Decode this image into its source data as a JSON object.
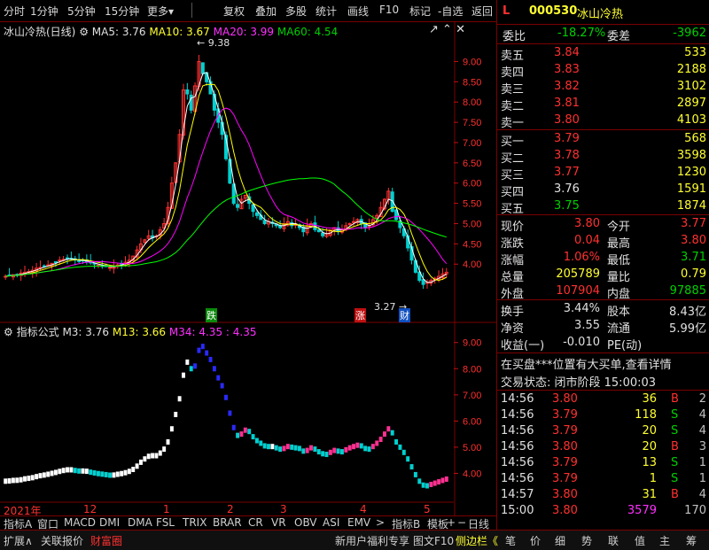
{
  "toolbar": {
    "items": [
      "分时",
      "1分钟",
      "5分钟",
      "15分钟",
      "更多",
      "复权",
      "叠加",
      "多股",
      "统计",
      "画线",
      "F10",
      "标记",
      "-自选",
      "返回"
    ]
  },
  "chart_header": {
    "title": "冰山冷热(日线)",
    "ma5": "MA5: 3.76",
    "ma10": "MA10: 3.67",
    "ma20": "MA20: 3.99",
    "ma60": "MA60: 4.54"
  },
  "indicator_header": {
    "title": "指标公式",
    "m3": "M3: 3.76",
    "m13": "M13: 3.66",
    "m34": "M34: 4.35 : 4.35"
  },
  "annotations": {
    "high": "9.38",
    "low": "3.27",
    "marker_die": "跌",
    "marker_zhang": "涨",
    "marker_cai": "财"
  },
  "colors": {
    "ma5": "#ffffff",
    "ma10": "#ffff00",
    "ma20": "#ff00ff",
    "ma60": "#00ff00",
    "up": "#ff3030",
    "down": "#00d0d0",
    "indicator_strong": "#2a2aff",
    "indicator_weak": "#ff3090"
  },
  "chart_data": {
    "type": "candlestick",
    "title": "冰山冷热(日线)",
    "ylim": [
      3.0,
      9.6
    ],
    "y_ticks": [
      "9.00",
      "8.50",
      "8.00",
      "7.50",
      "7.00",
      "6.50",
      "6.00",
      "5.50",
      "5.00",
      "4.50",
      "4.00"
    ],
    "indicator_ylim": [
      3.0,
      9.6
    ],
    "indicator_ticks": [
      "9.00",
      "8.00",
      "7.00",
      "6.00",
      "5.00",
      "4.00"
    ],
    "x_labels": [
      "2021年",
      "12",
      "1",
      "2",
      "3",
      "4",
      "5"
    ],
    "close": [
      3.7,
      3.72,
      3.74,
      3.73,
      3.78,
      3.8,
      3.82,
      3.85,
      3.9,
      3.92,
      3.95,
      3.98,
      4.02,
      4.05,
      4.1,
      4.12,
      4.15,
      4.12,
      4.1,
      4.08,
      4.1,
      4.06,
      4.03,
      4.0,
      3.98,
      3.96,
      3.94,
      3.92,
      3.95,
      3.98,
      4.0,
      4.05,
      4.1,
      4.2,
      4.35,
      4.5,
      4.6,
      4.7,
      4.65,
      4.7,
      4.85,
      5.0,
      5.4,
      6.0,
      6.5,
      7.2,
      8.3,
      8.2,
      7.8,
      8.4,
      9.0,
      8.7,
      8.5,
      8.2,
      7.8,
      7.5,
      7.2,
      6.6,
      6.0,
      5.5,
      5.4,
      5.6,
      5.7,
      5.5,
      5.3,
      5.2,
      5.1,
      5.0,
      5.05,
      5.0,
      4.95,
      4.9,
      5.0,
      5.05,
      4.95,
      5.0,
      4.9,
      4.8,
      4.95,
      5.0,
      4.85,
      4.8,
      4.7,
      4.75,
      4.85,
      4.9,
      4.8,
      4.85,
      4.95,
      5.0,
      5.05,
      5.1,
      5.0,
      4.9,
      4.95,
      5.1,
      5.2,
      5.4,
      5.6,
      5.8,
      5.3,
      5.1,
      4.9,
      4.7,
      4.4,
      4.1,
      3.8,
      3.6,
      3.5,
      3.55,
      3.6,
      3.65,
      3.7,
      3.76,
      3.8
    ],
    "ma5_last": 3.76,
    "ma10_last": 3.67,
    "ma20_last": 3.99,
    "ma60_last": 4.54,
    "high": 9.38,
    "low": 3.27
  },
  "quote": {
    "code": "000530",
    "name": "冰山冷热",
    "weibi_label": "委比",
    "weibi": "-18.27%",
    "weicha_label": "委差",
    "weicha": "-3962",
    "asks": [
      {
        "label": "卖五",
        "price": "3.84",
        "vol": "533"
      },
      {
        "label": "卖四",
        "price": "3.83",
        "vol": "2188"
      },
      {
        "label": "卖三",
        "price": "3.82",
        "vol": "3102"
      },
      {
        "label": "卖二",
        "price": "3.81",
        "vol": "2897"
      },
      {
        "label": "卖一",
        "price": "3.80",
        "vol": "4103"
      }
    ],
    "bids": [
      {
        "label": "买一",
        "price": "3.79",
        "vol": "568"
      },
      {
        "label": "买二",
        "price": "3.78",
        "vol": "3598"
      },
      {
        "label": "买三",
        "price": "3.77",
        "vol": "1230"
      },
      {
        "label": "买四",
        "price": "3.76",
        "vol": "1591"
      },
      {
        "label": "买五",
        "price": "3.75",
        "vol": "1874"
      }
    ],
    "stats": [
      {
        "l1": "现价",
        "v1": "3.80",
        "l2": "今开",
        "v2": "3.77"
      },
      {
        "l1": "涨跌",
        "v1": "0.04",
        "l2": "最高",
        "v2": "3.80"
      },
      {
        "l1": "涨幅",
        "v1": "1.06%",
        "l2": "最低",
        "v2": "3.71"
      },
      {
        "l1": "总量",
        "v1": "205789",
        "l2": "量比",
        "v2": "0.79"
      },
      {
        "l1": "外盘",
        "v1": "107904",
        "l2": "内盘",
        "v2": "97885"
      }
    ],
    "fin": [
      {
        "l1": "换手",
        "v1": "3.44%",
        "l2": "股本",
        "v2": "8.43亿"
      },
      {
        "l1": "净资",
        "v1": "3.55",
        "l2": "流通",
        "v2": "5.99亿"
      },
      {
        "l1": "收益(一)",
        "v1": "-0.010",
        "l2": "PE(动)",
        "v2": ""
      }
    ],
    "notice": "在买盘***位置有大买单,查看详情",
    "status": "交易状态: 闭市阶段 15:00:03",
    "ticks": [
      {
        "t": "14:56",
        "p": "3.80",
        "v": "36",
        "d": "B",
        "n": "2"
      },
      {
        "t": "14:56",
        "p": "3.79",
        "v": "118",
        "d": "S",
        "n": "4"
      },
      {
        "t": "14:56",
        "p": "3.79",
        "v": "20",
        "d": "S",
        "n": "4"
      },
      {
        "t": "14:56",
        "p": "3.80",
        "v": "20",
        "d": "B",
        "n": "3"
      },
      {
        "t": "14:56",
        "p": "3.79",
        "v": "13",
        "d": "S",
        "n": "1"
      },
      {
        "t": "14:56",
        "p": "3.79",
        "v": "1",
        "d": "S",
        "n": "1"
      },
      {
        "t": "14:57",
        "p": "3.80",
        "v": "31",
        "d": "B",
        "n": "4"
      },
      {
        "t": "15:00",
        "p": "3.80",
        "v": "3579",
        "d": "",
        "n": "170"
      }
    ]
  },
  "tabs": [
    "指标A",
    "窗口",
    "MACD",
    "DMI",
    "DMA",
    "FSL",
    "TRIX",
    "BRAR",
    "CR",
    "VR",
    "OBV",
    "ASI",
    "EMV",
    ">",
    "指标B",
    "模板",
    "+",
    "−",
    "日线"
  ],
  "bottom": {
    "left": [
      "扩展∧",
      "关联报价",
      "财富圈"
    ],
    "right_promo": "新用户福利专享",
    "right_items": [
      "图文F10",
      "侧边栏《",
      "笔",
      "价",
      "细",
      "势",
      "联",
      "值",
      "主",
      "筹"
    ]
  }
}
